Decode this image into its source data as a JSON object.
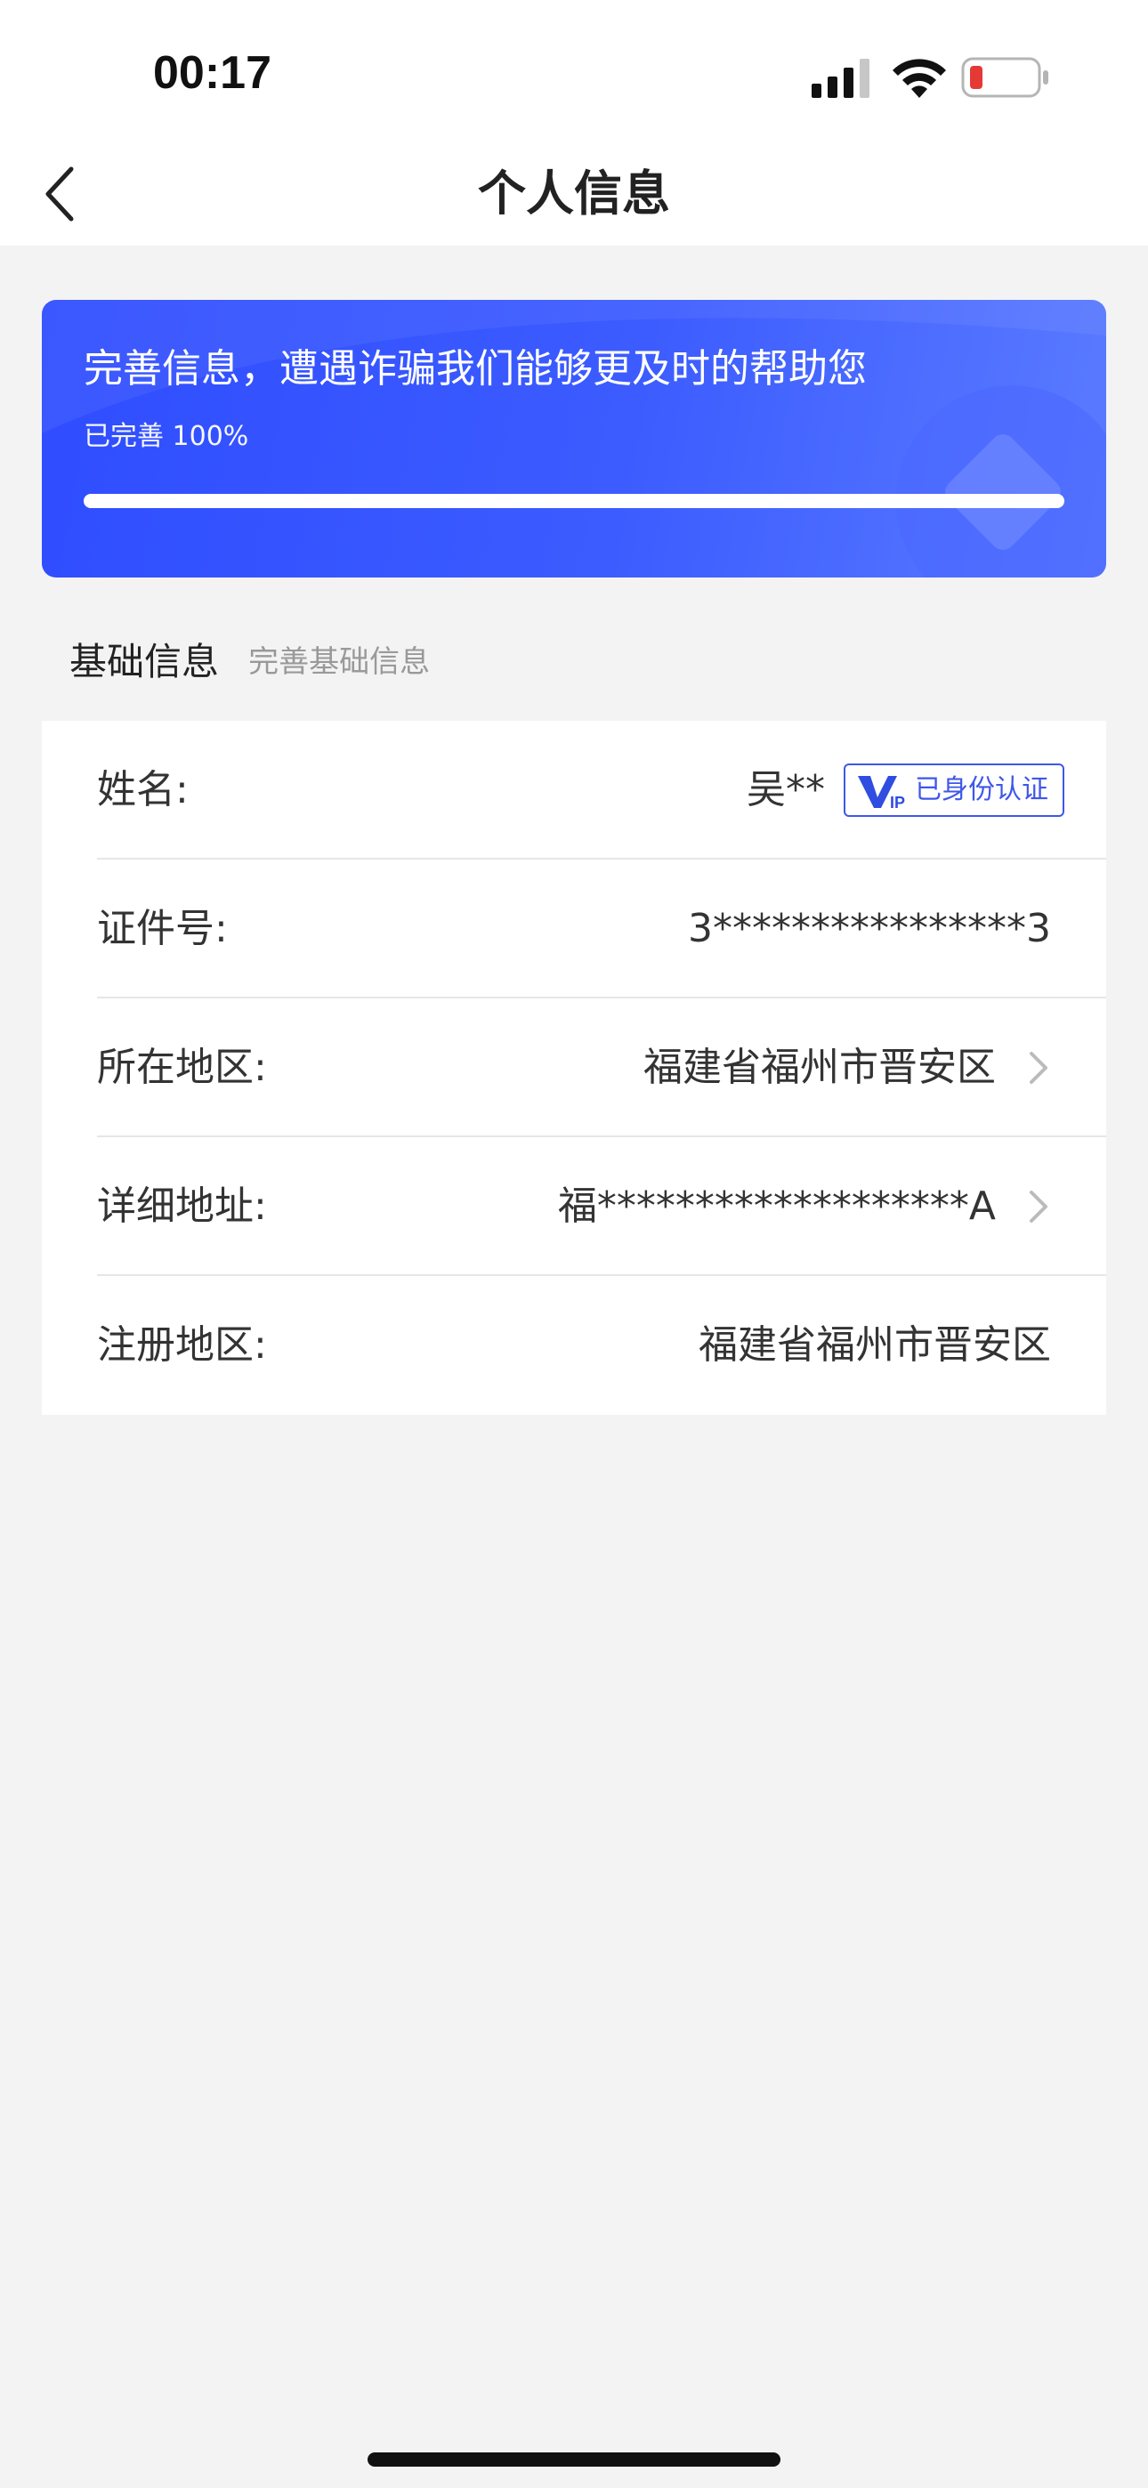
{
  "status_bar": {
    "time": "00:17",
    "icons": [
      "cellular-signal-icon",
      "wifi-icon",
      "battery-low-icon"
    ],
    "battery_color": "#e53935"
  },
  "nav": {
    "title": "个人信息",
    "back_icon": "chevron-left-icon"
  },
  "banner": {
    "title": "完善信息，遭遇诈骗我们能够更及时的帮助您",
    "progress_label": "已完善 100%",
    "progress": 1.0,
    "colors": {
      "start": "#2f4dff",
      "end": "#5a7bff"
    }
  },
  "section": {
    "title": "基础信息",
    "subtitle": "完善基础信息"
  },
  "fields": {
    "name": {
      "label": "姓名:",
      "value": "吴**",
      "badge": "已身份认证",
      "badge_logo": "VIP"
    },
    "id_number": {
      "label": "证件号:",
      "value": "3****************3"
    },
    "region": {
      "label": "所在地区:",
      "value": "福建省福州市晋安区"
    },
    "address": {
      "label": "详细地址:",
      "value": "福*******************A"
    },
    "registered_region": {
      "label": "注册地区:",
      "value": "福建省福州市晋安区"
    }
  },
  "accent_color": "#3f57e8"
}
